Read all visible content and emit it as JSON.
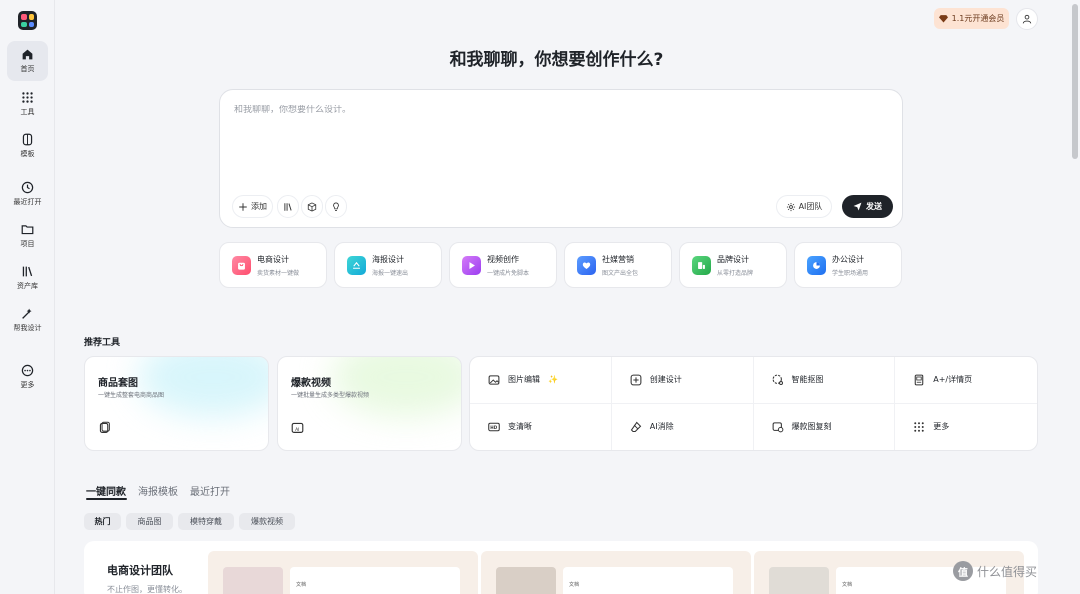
{
  "sidebar": {
    "items": [
      {
        "label": "首页",
        "icon": "home-icon"
      },
      {
        "label": "工具",
        "icon": "grid-icon"
      },
      {
        "label": "模板",
        "icon": "template-icon"
      },
      {
        "label": "最近打开",
        "icon": "clock-icon"
      },
      {
        "label": "项目",
        "icon": "folder-icon"
      },
      {
        "label": "资产库",
        "icon": "library-icon"
      },
      {
        "label": "帮我设计",
        "icon": "magic-icon"
      },
      {
        "label": "更多",
        "icon": "more-icon"
      }
    ]
  },
  "header": {
    "vip_label": "1.1元开通会员"
  },
  "headline": "和我聊聊，你想要创作什么?",
  "prompt": {
    "placeholder": "和我聊聊，你想要什么设计。",
    "add_label": "添加",
    "team_label": "AI团队",
    "send_label": "发送"
  },
  "categories": [
    {
      "title": "电商设计",
      "sub": "卖货素材一键做",
      "color": "#ff6b8a"
    },
    {
      "title": "海报设计",
      "sub": "海报一键速出",
      "color": "#20c3d0"
    },
    {
      "title": "视频创作",
      "sub": "一键成片免脚本",
      "color": "#b85cf5"
    },
    {
      "title": "社媒营销",
      "sub": "图文产出全包",
      "color": "#3a7bfa"
    },
    {
      "title": "品牌设计",
      "sub": "从零打造品牌",
      "color": "#35c25a"
    },
    {
      "title": "办公设计",
      "sub": "学生职场通用",
      "color": "#2f86f6"
    }
  ],
  "recommended": {
    "title": "推荐工具",
    "cards": [
      {
        "title": "商品套图",
        "sub": "一键生成整套电商商品图"
      },
      {
        "title": "爆款视频",
        "sub": "一键批量生成多类型爆款视频"
      }
    ],
    "grid": [
      {
        "label": "图片编辑",
        "icon": "image-edit-icon"
      },
      {
        "label": "创建设计",
        "icon": "plus-circle-icon"
      },
      {
        "label": "智能抠图",
        "icon": "cutout-icon"
      },
      {
        "label": "A+/详情页",
        "icon": "detail-page-icon"
      },
      {
        "label": "变清晰",
        "icon": "hd-icon"
      },
      {
        "label": "AI消除",
        "icon": "eraser-icon"
      },
      {
        "label": "爆款图复刻",
        "icon": "copy-image-icon"
      },
      {
        "label": "更多",
        "icon": "dots-grid-icon"
      }
    ]
  },
  "tabs": [
    "一键同款",
    "海报模板",
    "最近打开"
  ],
  "chips": [
    "热门",
    "商品图",
    "模特穿戴",
    "爆款视频"
  ],
  "team": {
    "title": "电商设计团队",
    "sub": "不止作图，更懂转化。",
    "tag": "文档"
  },
  "watermark": "什么值得买"
}
